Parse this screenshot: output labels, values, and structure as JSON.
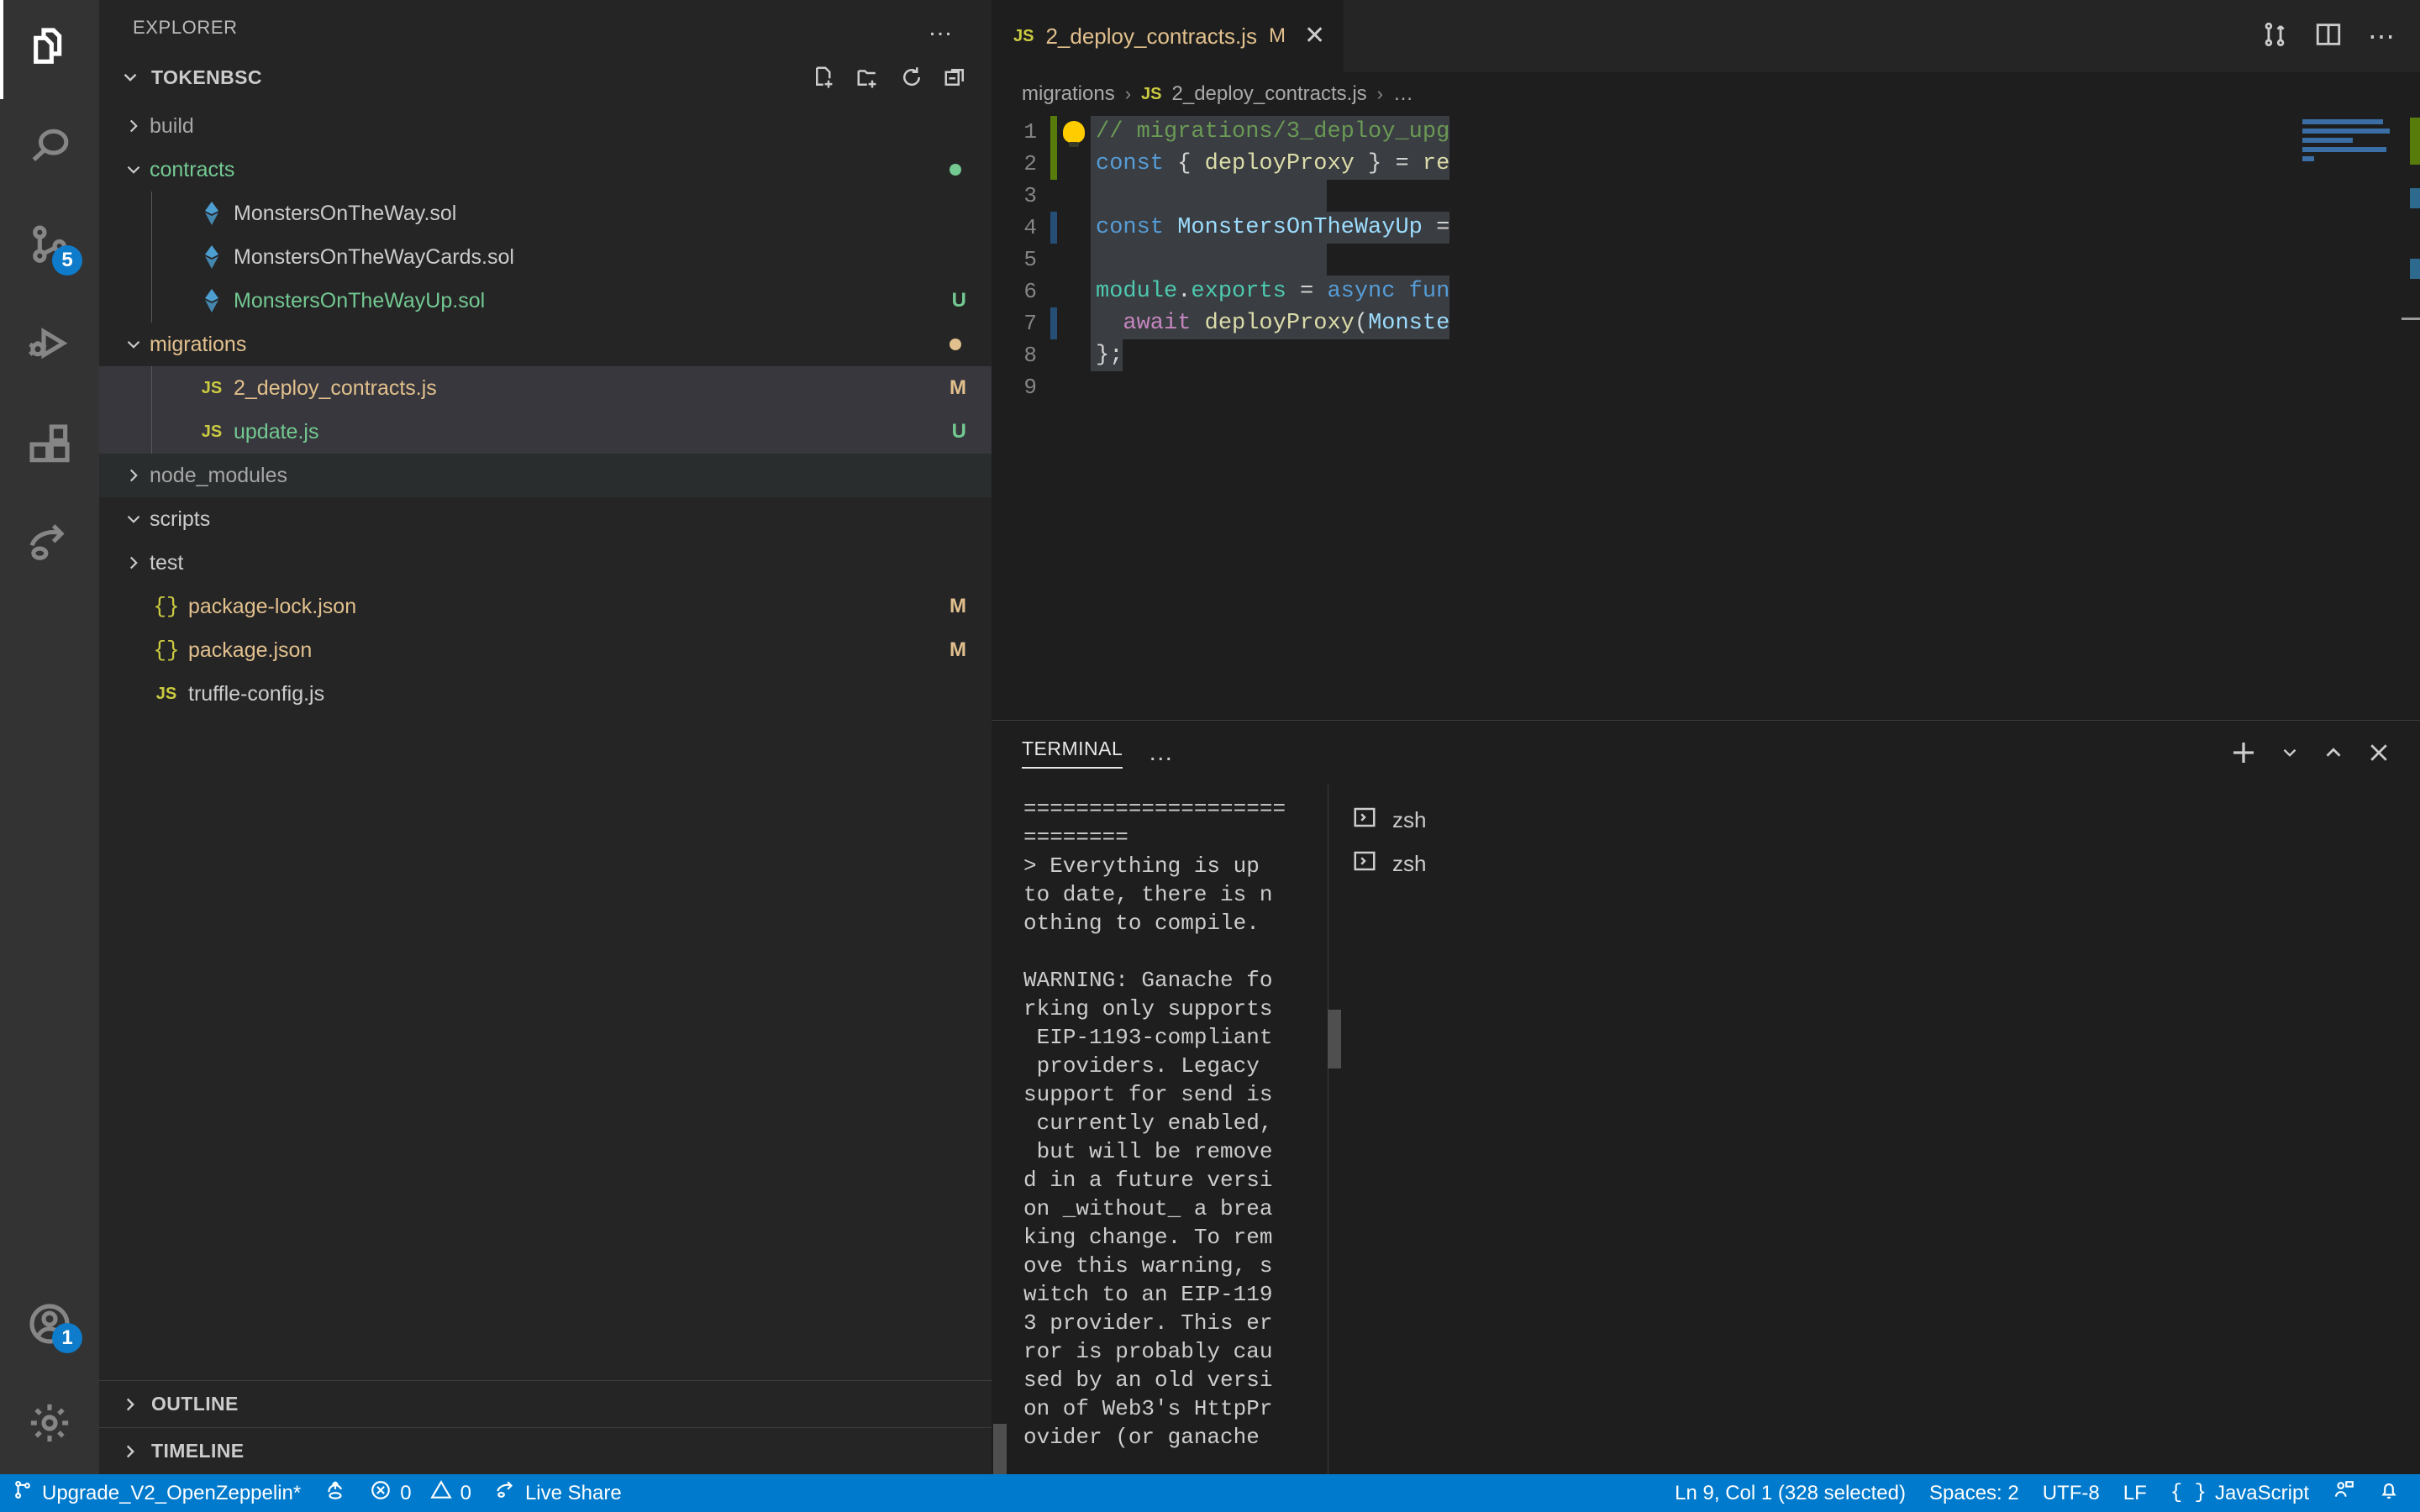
{
  "activity_bar": {
    "items": [
      {
        "name": "explorer",
        "icon": "files-icon",
        "active": true,
        "badge": null
      },
      {
        "name": "search",
        "icon": "search-icon",
        "active": false,
        "badge": null
      },
      {
        "name": "source-control",
        "icon": "source-control-icon",
        "active": false,
        "badge": "5"
      },
      {
        "name": "run-and-debug",
        "icon": "debug-icon",
        "active": false,
        "badge": null
      },
      {
        "name": "extensions",
        "icon": "extensions-icon",
        "active": false,
        "badge": null
      },
      {
        "name": "live-share",
        "icon": "live-share-icon",
        "active": false,
        "badge": null
      }
    ],
    "bottom_items": [
      {
        "name": "accounts",
        "icon": "account-icon",
        "badge": "1"
      },
      {
        "name": "settings",
        "icon": "gear-icon",
        "badge": null
      }
    ]
  },
  "sidebar": {
    "title": "EXPLORER",
    "more_label": "…",
    "root": {
      "label": "TOKENBSC",
      "actions": [
        "new-file-icon",
        "new-folder-icon",
        "refresh-icon",
        "collapse-all-icon"
      ]
    },
    "tree": [
      {
        "label": "build",
        "kind": "folder",
        "expanded": false,
        "indent": 1,
        "color": "dim",
        "status": "",
        "state": ""
      },
      {
        "label": "contracts",
        "kind": "folder",
        "expanded": true,
        "indent": 1,
        "color": "unt",
        "status": "",
        "state": "",
        "dot": "#73c991"
      },
      {
        "label": "MonstersOnTheWay.sol",
        "kind": "sol",
        "indent": 3,
        "color": "default",
        "status": "",
        "state": ""
      },
      {
        "label": "MonstersOnTheWayCards.sol",
        "kind": "sol",
        "indent": 3,
        "color": "default",
        "status": "",
        "state": ""
      },
      {
        "label": "MonstersOnTheWayUp.sol",
        "kind": "sol",
        "indent": 3,
        "color": "unt",
        "status": "U",
        "state": ""
      },
      {
        "label": "migrations",
        "kind": "folder",
        "expanded": true,
        "indent": 1,
        "color": "mod",
        "status": "",
        "state": "",
        "dot": "#e2c08d"
      },
      {
        "label": "2_deploy_contracts.js",
        "kind": "js",
        "indent": 3,
        "color": "mod",
        "status": "M",
        "state": "selected"
      },
      {
        "label": "update.js",
        "kind": "js",
        "indent": 3,
        "color": "unt",
        "status": "U",
        "state": "selected"
      },
      {
        "label": "node_modules",
        "kind": "folder",
        "expanded": false,
        "indent": 1,
        "color": "dim",
        "status": "",
        "state": "hovered"
      },
      {
        "label": "scripts",
        "kind": "folder",
        "expanded": true,
        "indent": 1,
        "color": "default",
        "status": "",
        "state": ""
      },
      {
        "label": "test",
        "kind": "folder",
        "expanded": false,
        "indent": 1,
        "color": "default",
        "status": "",
        "state": ""
      },
      {
        "label": "package-lock.json",
        "kind": "json",
        "indent": 1,
        "color": "mod",
        "status": "M",
        "state": ""
      },
      {
        "label": "package.json",
        "kind": "json",
        "indent": 1,
        "color": "mod",
        "status": "M",
        "state": ""
      },
      {
        "label": "truffle-config.js",
        "kind": "js",
        "indent": 1,
        "color": "default",
        "status": "",
        "state": ""
      }
    ],
    "panels": [
      {
        "label": "OUTLINE",
        "expanded": false
      },
      {
        "label": "TIMELINE",
        "expanded": false
      }
    ]
  },
  "editor": {
    "tab": {
      "icon": "js-file-icon",
      "label": "2_deploy_contracts.js",
      "dirty_badge": "M",
      "close_label": "✕"
    },
    "tab_actions": [
      "split-vertical-icon",
      "split-editor-icon",
      "more-actions-icon"
    ],
    "breadcrumb": [
      "migrations",
      "2_deploy_contracts.js",
      "…"
    ],
    "lines": [
      {
        "n": "1",
        "gutter": "add",
        "bulb": true,
        "selected": true,
        "tokens": [
          {
            "t": "// migrations/3_deploy_upg",
            "c": "com"
          }
        ]
      },
      {
        "n": "2",
        "gutter": "add",
        "bulb": false,
        "selected": true,
        "tokens": [
          {
            "t": "const",
            "c": "kw"
          },
          {
            "t": " { ",
            "c": "pl"
          },
          {
            "t": "deployProxy",
            "c": "fn"
          },
          {
            "t": " } ",
            "c": "pl"
          },
          {
            "t": "= ",
            "c": "pl"
          },
          {
            "t": "re",
            "c": "fn"
          }
        ]
      },
      {
        "n": "3",
        "gutter": "",
        "bulb": false,
        "selected": true,
        "tokens": []
      },
      {
        "n": "4",
        "gutter": "sel",
        "bulb": false,
        "selected": true,
        "tokens": [
          {
            "t": "const ",
            "c": "kw"
          },
          {
            "t": "MonstersOnTheWayUp",
            "c": "var"
          },
          {
            "t": " =",
            "c": "pl"
          }
        ]
      },
      {
        "n": "5",
        "gutter": "",
        "bulb": false,
        "selected": true,
        "tokens": []
      },
      {
        "n": "6",
        "gutter": "",
        "bulb": false,
        "selected": true,
        "tokens": [
          {
            "t": "module",
            "c": "gr"
          },
          {
            "t": ".",
            "c": "pl"
          },
          {
            "t": "exports",
            "c": "gr"
          },
          {
            "t": " = ",
            "c": "pl"
          },
          {
            "t": "async ",
            "c": "kw"
          },
          {
            "t": "fun",
            "c": "kw"
          }
        ]
      },
      {
        "n": "7",
        "gutter": "sel",
        "bulb": false,
        "selected": true,
        "tokens": [
          {
            "t": "  ",
            "c": "pl"
          },
          {
            "t": "await ",
            "c": "kw2"
          },
          {
            "t": "deployProxy",
            "c": "fn"
          },
          {
            "t": "(",
            "c": "pl"
          },
          {
            "t": "Monste",
            "c": "var"
          }
        ]
      },
      {
        "n": "8",
        "gutter": "",
        "bulb": false,
        "selected": true,
        "tokens": [
          {
            "t": "};",
            "c": "pl"
          }
        ]
      },
      {
        "n": "9",
        "gutter": "",
        "bulb": false,
        "selected": false,
        "tokens": []
      }
    ]
  },
  "terminal": {
    "tab_label": "TERMINAL",
    "more_label": "…",
    "actions": [
      "new-terminal-icon",
      "chevron-down-icon",
      "chevron-up-icon",
      "close-icon"
    ],
    "output": "====================\n========\n> Everything is up\nto date, there is n\nothing to compile.\n\nWARNING: Ganache fo\nrking only supports\n EIP-1193-compliant\n providers. Legacy\nsupport for send is\n currently enabled,\n but will be remove\nd in a future versi\non _without_ a brea\nking change. To rem\nove this warning, s\nwitch to an EIP-119\n3 provider. This er\nror is probably cau\nsed by an old versi\non of Web3's HttpPr\novider (or ganache",
    "instances": [
      {
        "label": "zsh",
        "icon": "terminal-icon"
      },
      {
        "label": "zsh",
        "icon": "terminal-icon"
      }
    ]
  },
  "status_bar": {
    "left": [
      {
        "name": "branch",
        "icon": "source-control-icon",
        "label": "Upgrade_V2_OpenZeppelin*"
      },
      {
        "name": "sync",
        "icon": "sync-icon",
        "label": ""
      },
      {
        "name": "problems",
        "icon": "error-warning-icons",
        "label": "0",
        "label2": "0"
      },
      {
        "name": "live-share",
        "icon": "live-share-icon",
        "label": "Live Share"
      }
    ],
    "right": [
      {
        "name": "cursor-position",
        "label": "Ln 9, Col 1 (328 selected)"
      },
      {
        "name": "indentation",
        "label": "Spaces: 2"
      },
      {
        "name": "encoding",
        "label": "UTF-8"
      },
      {
        "name": "eol",
        "label": "LF"
      },
      {
        "name": "language-mode",
        "label": "JavaScript",
        "icon": "json-braces-icon"
      },
      {
        "name": "feedback",
        "label": "",
        "icon": "feedback-icon"
      },
      {
        "name": "notifications",
        "label": "",
        "icon": "bell-icon"
      }
    ]
  },
  "colors": {
    "accent": "#007acc",
    "modified": "#e2c08d",
    "untracked": "#73c991",
    "badge": "#0e7bcb",
    "selection": "#264f78"
  }
}
